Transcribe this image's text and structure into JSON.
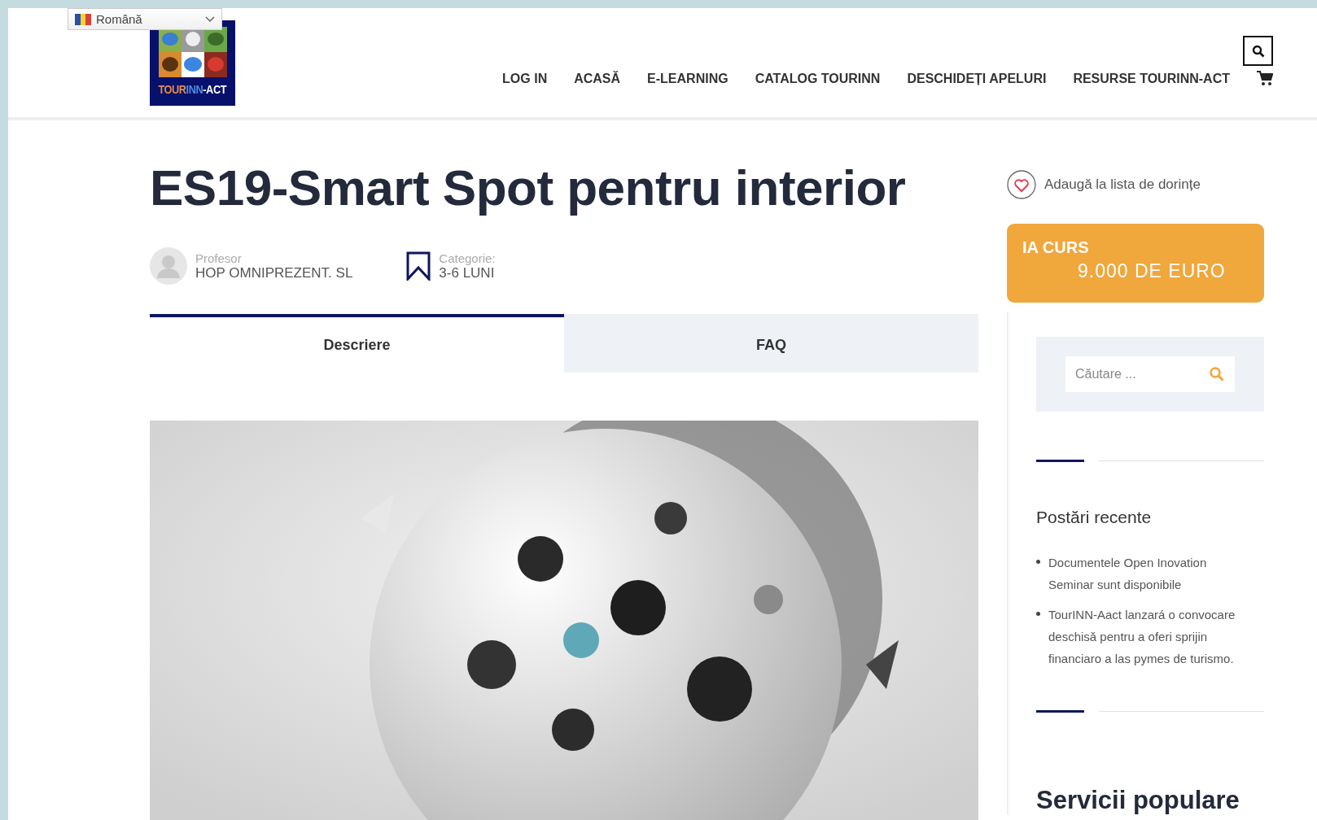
{
  "language_selector": {
    "label": "Română"
  },
  "header": {
    "logo": {
      "parts": [
        {
          "text": "TOUR",
          "color": "#e08a4c"
        },
        {
          "text": "INN",
          "color": "#4a8be0"
        },
        {
          "text": "-ACT",
          "color": "#ffffff"
        }
      ]
    },
    "nav": [
      {
        "label": "LOG IN"
      },
      {
        "label": "ACASĂ"
      },
      {
        "label": "E-LEARNING"
      },
      {
        "label": "CATALOG TOURINN"
      },
      {
        "label": "DESCHIDEȚI APELURI"
      },
      {
        "label": "RESURSE TOURINN-ACT"
      }
    ]
  },
  "course": {
    "title": "ES19-Smart Spot pentru interior",
    "instructor": {
      "label": "Profesor",
      "name": "HOP OMNIPREZENT. SL"
    },
    "category": {
      "label": "Categorie:",
      "value": "3-6 LUNI"
    },
    "tabs": [
      {
        "label": "Descriere",
        "selected": true
      },
      {
        "label": "FAQ",
        "selected": false
      }
    ]
  },
  "sidebar": {
    "wishlist": {
      "label": "Adaugă la lista de dorințe"
    },
    "take_course": {
      "label": "IA CURS",
      "price": "9.000 DE EURO"
    },
    "search": {
      "placeholder": "Căutare ..."
    },
    "recent_posts": {
      "title": "Postări recente",
      "items": [
        "Documentele Open Inovation Seminar sunt disponibile",
        "TourINN-Aact lanzará o convocare deschisă pentru a oferi sprijin financiaro a las pymes de turismo."
      ]
    },
    "popular_services": {
      "title": "Servicii populare"
    }
  }
}
